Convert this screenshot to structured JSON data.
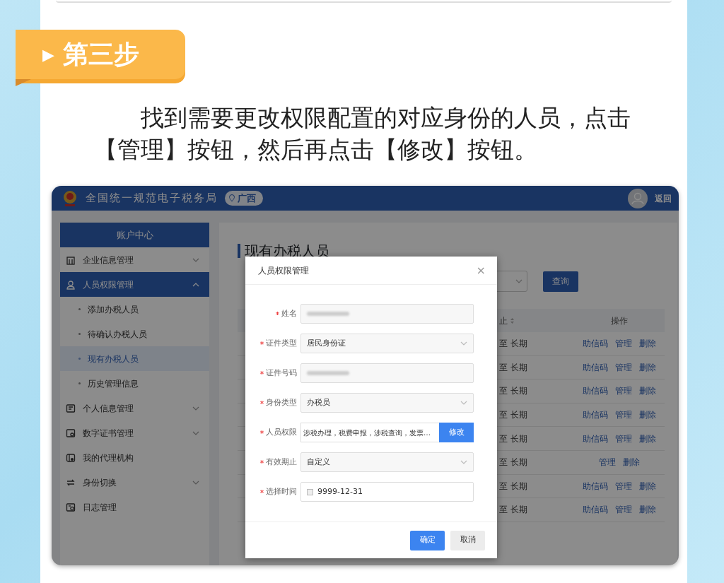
{
  "step_badge": {
    "marker": "▶",
    "label": "第三步"
  },
  "instruction": "找到需要更改权限配置的对应身份的人员，点击【管理】按钮，然后再点击【修改】按钮。",
  "app": {
    "site_title": "全国统一规范电子税务局",
    "region": "广西",
    "back_link": "返回",
    "sidebar": {
      "title": "账户中心",
      "items": [
        {
          "label": "企业信息管理",
          "expanded": false,
          "selected": false
        },
        {
          "label": "人员权限管理",
          "expanded": true,
          "selected": true,
          "children": [
            {
              "label": "添加办税人员",
              "selected": false
            },
            {
              "label": "待确认办税人员",
              "selected": false
            },
            {
              "label": "现有办税人员",
              "selected": true
            },
            {
              "label": "历史管理信息",
              "selected": false
            }
          ]
        },
        {
          "label": "个人信息管理",
          "expanded": false,
          "selected": false
        },
        {
          "label": "数字证书管理",
          "expanded": false,
          "selected": false
        },
        {
          "label": "我的代理机构",
          "selected": false
        },
        {
          "label": "身份切换",
          "expanded": false,
          "selected": false
        },
        {
          "label": "日志管理",
          "selected": false
        }
      ]
    },
    "page_title": "现有办税人员",
    "search_button": "查询",
    "table": {
      "columns": [
        "止",
        "操作"
      ],
      "rows": [
        {
          "column_1": "至 长期",
          "actions": [
            "助信码",
            "管理",
            "删除"
          ]
        },
        {
          "column_1": "至 长期",
          "actions": [
            "助信码",
            "管理",
            "删除"
          ]
        },
        {
          "column_1": "至 长期",
          "actions": [
            "助信码",
            "管理",
            "删除"
          ]
        },
        {
          "column_1": "至 长期",
          "actions": [
            "助信码",
            "管理",
            "删除"
          ]
        },
        {
          "column_1": "至 长期",
          "actions": [
            "助信码",
            "管理",
            "删除"
          ]
        },
        {
          "column_1": "至 长期",
          "actions": [
            "管理",
            "删除"
          ]
        },
        {
          "column_1": "至 长期",
          "actions": [
            "助信码",
            "管理",
            "删除"
          ]
        },
        {
          "column_1": "至 长期",
          "actions": [
            "助信码",
            "管理",
            "删除"
          ]
        }
      ]
    }
  },
  "dialog": {
    "title": "人员权限管理",
    "close": "×",
    "fields": [
      {
        "label": "姓名",
        "required": true,
        "kind": "masked"
      },
      {
        "label": "证件类型",
        "required": true,
        "kind": "select",
        "value": "居民身份证"
      },
      {
        "label": "证件号码",
        "required": true,
        "kind": "masked"
      },
      {
        "label": "身份类型",
        "required": true,
        "kind": "select",
        "value": "办税员"
      },
      {
        "label": "人员权限",
        "required": true,
        "kind": "text-button",
        "value": "涉税办理，税费申报，涉税查询，发票…",
        "button": "修改"
      },
      {
        "label": "有效期止",
        "required": true,
        "kind": "select",
        "value": "自定义"
      },
      {
        "label": "选择时间",
        "required": true,
        "kind": "date",
        "value": "9999-12-31"
      }
    ],
    "buttons": [
      {
        "label": "确定",
        "primary": true
      },
      {
        "label": "取消",
        "primary": false
      }
    ]
  }
}
